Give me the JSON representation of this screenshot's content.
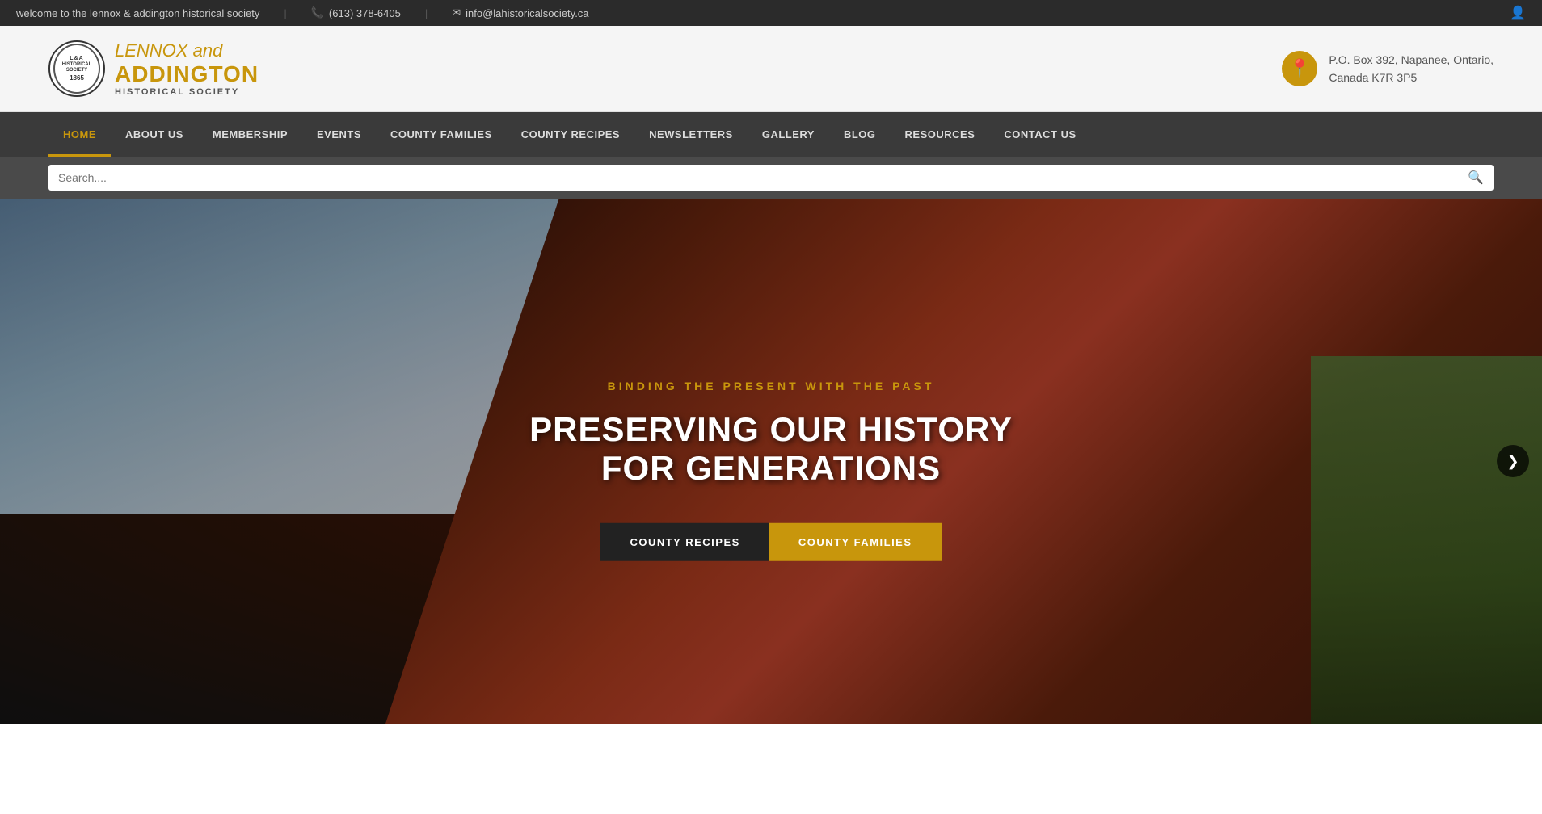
{
  "topbar": {
    "welcome": "welcome to the lennox & addington historical society",
    "phone": "(613) 378-6405",
    "email": "info@lahistoricalsociety.ca",
    "phone_icon": "📞",
    "email_icon": "✉",
    "social_icon": "👤"
  },
  "header": {
    "logo": {
      "circle_text": "L&A\nHISTORICAL\nSOCIETY\n1865",
      "lennox": "LENNOX",
      "and": "and",
      "addington": "ADDINGTON",
      "sub": "HISTORICAL SOCIETY"
    },
    "address": {
      "line1": "P.O. Box 392, Napanee, Ontario,",
      "line2": "Canada K7R 3P5",
      "pin_icon": "📍"
    }
  },
  "nav": {
    "items": [
      {
        "label": "HOME",
        "active": true
      },
      {
        "label": "ABOUT US",
        "active": false
      },
      {
        "label": "MEMBERSHIP",
        "active": false
      },
      {
        "label": "EVENTS",
        "active": false
      },
      {
        "label": "COUNTY FAMILIES",
        "active": false
      },
      {
        "label": "COUNTY RECIPES",
        "active": false
      },
      {
        "label": "NEWSLETTERS",
        "active": false
      },
      {
        "label": "GALLERY",
        "active": false
      },
      {
        "label": "BLOG",
        "active": false
      },
      {
        "label": "RESOURCES",
        "active": false
      },
      {
        "label": "CONTACT US",
        "active": false
      }
    ]
  },
  "search": {
    "placeholder": "Search...."
  },
  "hero": {
    "subtitle": "BINDING THE PRESENT WITH THE PAST",
    "title": "PRESERVING OUR HISTORY FOR GENERATIONS",
    "btn1": "COUNTY RECIPES",
    "btn2": "COUNTY FAMILIES",
    "arrow_right": "❯"
  }
}
